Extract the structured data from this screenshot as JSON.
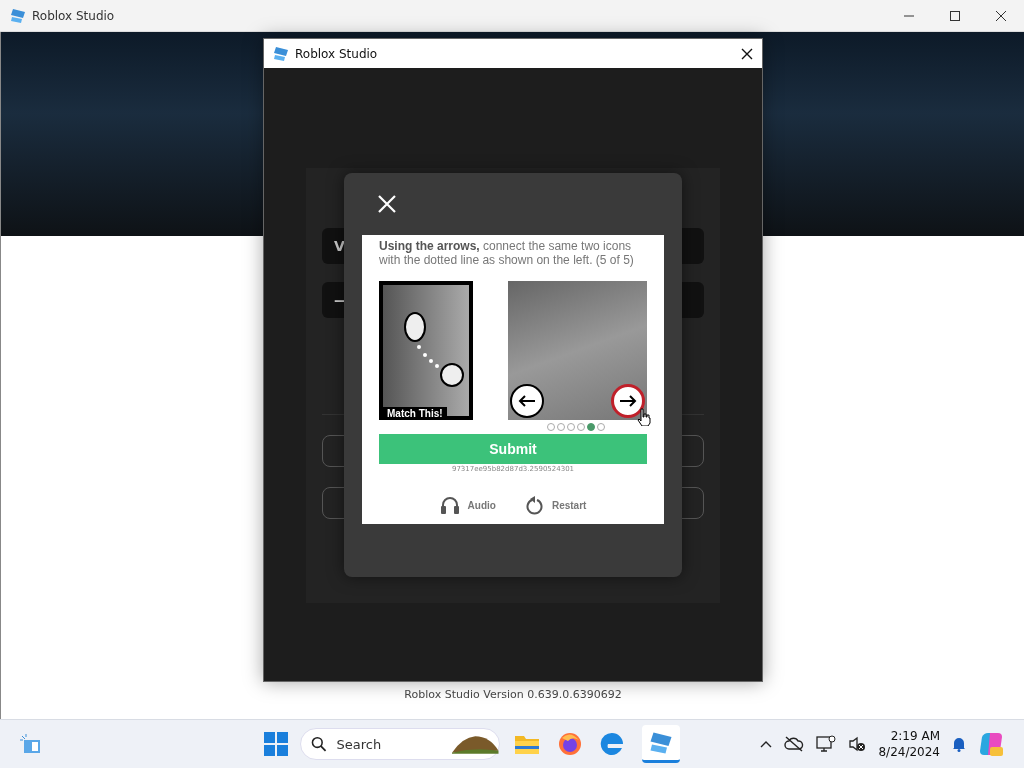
{
  "window": {
    "title": "Roblox Studio"
  },
  "dialog": {
    "title": "Roblox Studio",
    "version": "Roblox Studio Version 0.639.0.6390692",
    "background_fields": [
      {
        "text": "V"
      },
      {
        "text": "—"
      }
    ]
  },
  "captcha": {
    "instruction": "**Using the arrows,** connect the same two icons with the dotted line as shown on the left. (5 of 5)",
    "example_label": "Match This!",
    "arrows": [
      {
        "kind": "left",
        "highlighted": false
      },
      {
        "kind": "right",
        "highlighted": true
      }
    ],
    "pages": [
      {
        "selected": false
      },
      {
        "selected": false
      },
      {
        "selected": false
      },
      {
        "selected": false
      },
      {
        "selected": true
      },
      {
        "selected": false
      }
    ],
    "submit": "Submit",
    "session_id": "97317ee95b82d87d3.2590524301",
    "links": [
      {
        "kind": "audio",
        "label": "Audio"
      },
      {
        "kind": "restart",
        "label": "Restart"
      }
    ]
  },
  "taskbar": {
    "search_placeholder": "Search",
    "time": "2:19 AM",
    "date": "8/24/2024"
  }
}
